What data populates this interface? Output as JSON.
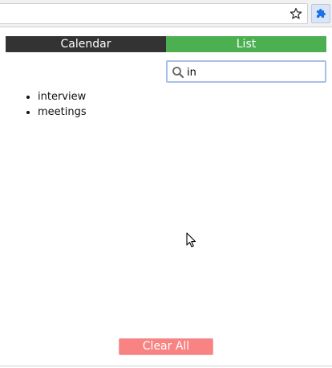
{
  "browser": {
    "icons": [
      "star-icon",
      "puzzle-icon"
    ]
  },
  "tabs": [
    {
      "label": "Calendar",
      "active": false
    },
    {
      "label": "List",
      "active": true
    }
  ],
  "search": {
    "value": "in",
    "icon": "search-icon"
  },
  "results": {
    "items": [
      "interview",
      "meetings"
    ]
  },
  "actions": {
    "clear_all_label": "Clear All"
  },
  "colors": {
    "calendar_tab": "#333333",
    "list_tab": "#4caf50",
    "clear_button": "#f98383",
    "search_border": "#a8c0e8"
  }
}
